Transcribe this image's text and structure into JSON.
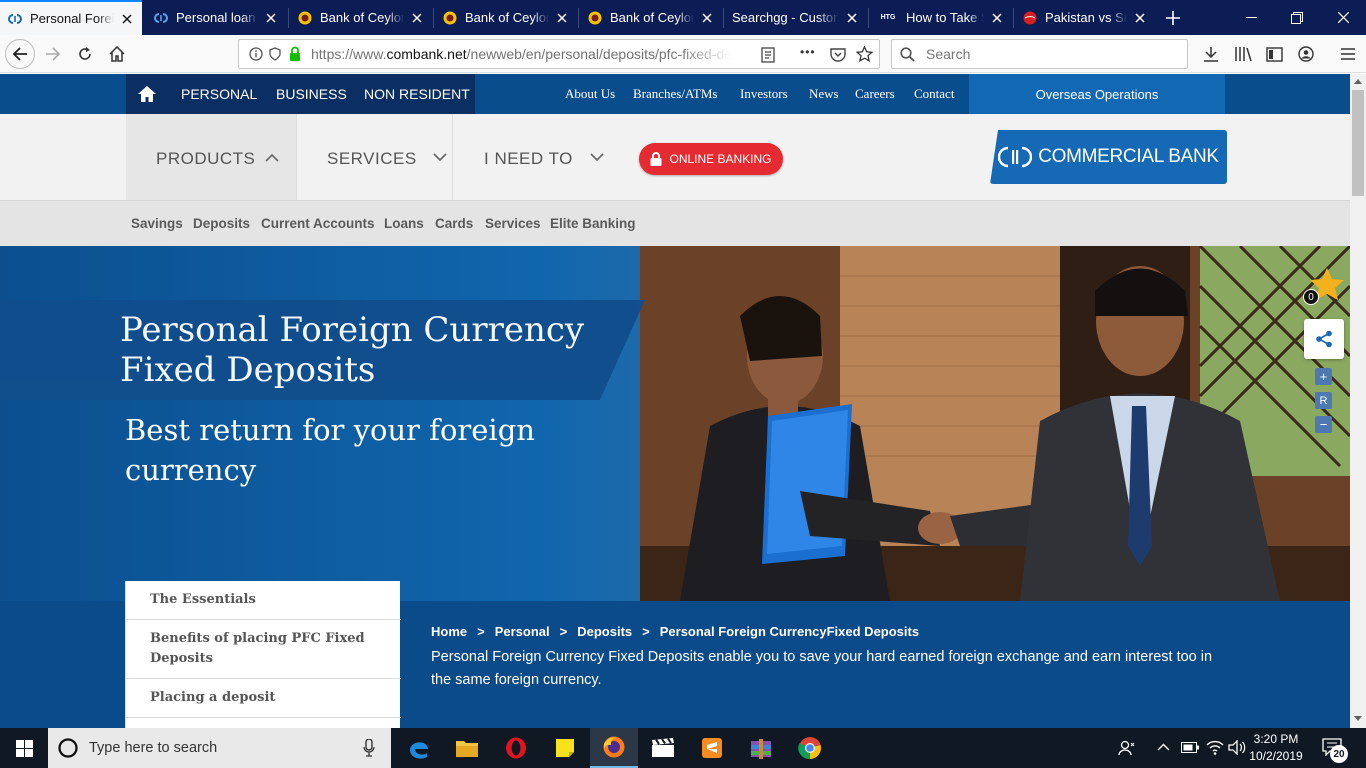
{
  "browser": {
    "tabs": [
      {
        "title": "Personal Foreign Currency Fixed Deposits",
        "favicon": "combank-icon",
        "active": true
      },
      {
        "title": "Personal loan | Fixed Deposits",
        "favicon": "combank-icon",
        "active": false
      },
      {
        "title": "Bank of Ceylon",
        "favicon": "boc-icon",
        "active": false
      },
      {
        "title": "Bank of Ceylon",
        "favicon": "boc-icon",
        "active": false
      },
      {
        "title": "Bank of Ceylon",
        "favicon": "boc-icon",
        "active": false
      },
      {
        "title": "Searchgg - Customized",
        "favicon": "",
        "active": false
      },
      {
        "title": "How to Take Screenshots",
        "favicon": "htg-icon",
        "active": false
      },
      {
        "title": "Pakistan vs Sri Lanka",
        "favicon": "cricket-icon",
        "active": false
      }
    ],
    "htg_label": "HTG",
    "url_prefix": "https://www.",
    "url_domain": "combank.net",
    "url_path": "/newweb/en/personal/deposits/pfc-fixed-deposits",
    "search_placeholder": "Search",
    "more_label": "•••"
  },
  "site": {
    "segments": [
      "PERSONAL",
      "BUSINESS",
      "NON RESIDENT"
    ],
    "top_links": [
      "About Us",
      "Branches/ATMs",
      "Investors",
      "News",
      "Careers",
      "Contact"
    ],
    "overseas": "Overseas Operations",
    "main_menu": [
      "PRODUCTS",
      "SERVICES",
      "I NEED TO"
    ],
    "online_banking": "ONLINE BANKING",
    "logo_text": "COMMERCIAL BANK",
    "sub_menu": [
      "Savings",
      "Deposits",
      "Current Accounts",
      "Loans",
      "Cards",
      "Services",
      "Elite Banking"
    ],
    "hero_title": "Personal Foreign Currency Fixed Deposits",
    "hero_subtitle": "Best return for your foreign currency",
    "star_count": "0",
    "zoom_in": "+",
    "zoom_reset": "R",
    "zoom_out": "−",
    "side_menu": [
      "The Essentials",
      "Benefits of placing PFC Fixed Deposits",
      "Placing a deposit"
    ],
    "breadcrumb": [
      "Home",
      "Personal",
      "Deposits",
      "Personal Foreign CurrencyFixed Deposits"
    ],
    "breadcrumb_sep": ">",
    "description": "Personal Foreign Currency Fixed Deposits enable you to save your hard earned foreign exchange and earn interest too in the same foreign currency."
  },
  "taskbar": {
    "search_placeholder": "Type here to search",
    "time": "3:20 PM",
    "date": "10/2/2019",
    "notification_count": "20"
  },
  "colors": {
    "brand_blue": "#0a4d8c",
    "dark_blue": "#0c2f63",
    "accent_red": "#e52a32",
    "logo_blue": "#1569b5"
  }
}
